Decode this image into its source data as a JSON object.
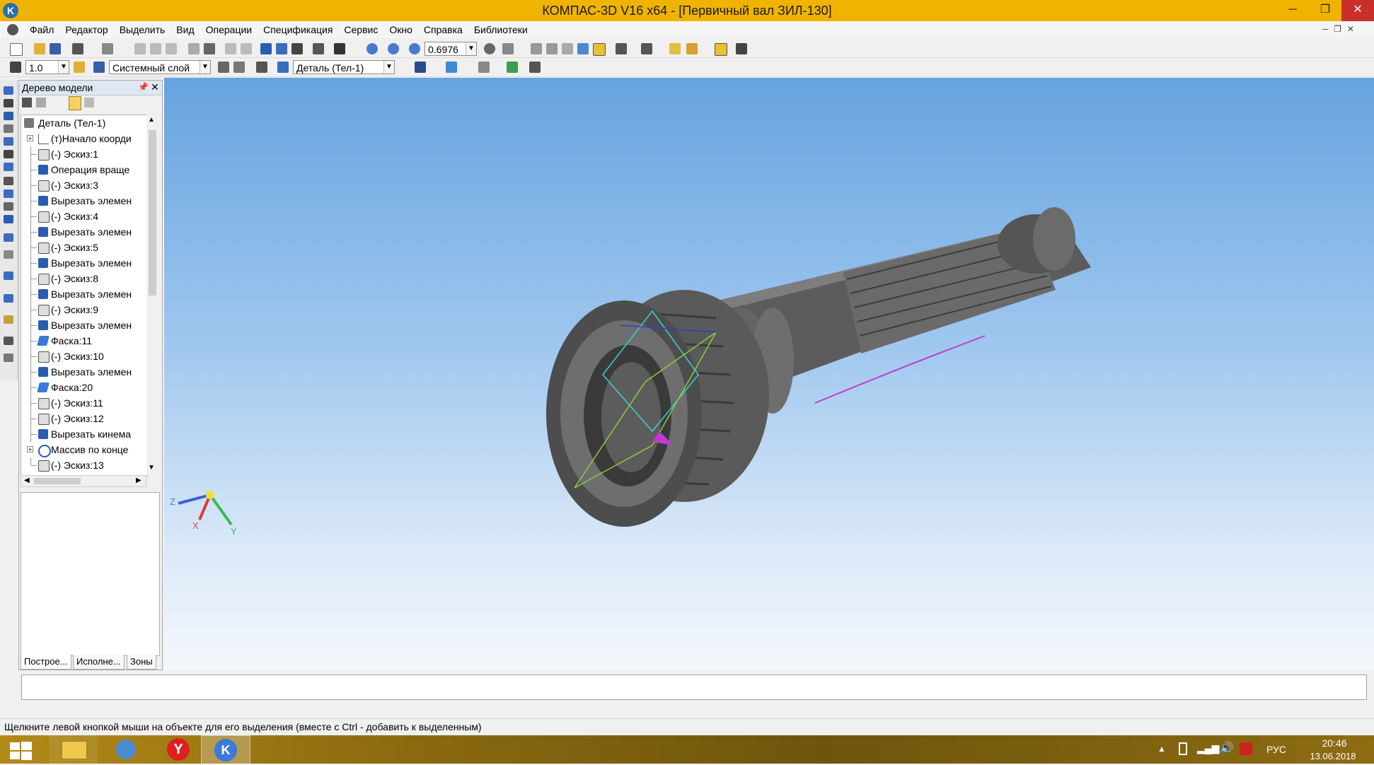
{
  "window": {
    "title": "КОМПАС-3D V16  x64 - [Первичный вал ЗИЛ-130]",
    "minimize_icon": "─",
    "maximize_icon": "❐",
    "close_icon": "✕"
  },
  "menu": [
    "Файл",
    "Редактор",
    "Выделить",
    "Вид",
    "Операции",
    "Спецификация",
    "Сервис",
    "Окно",
    "Справка",
    "Библиотеки"
  ],
  "toolbar": {
    "zoom_value": "0.6976",
    "line_style_value": "1.0",
    "layer_value": "Системный слой",
    "part_value": "Деталь (Тел-1)"
  },
  "tree": {
    "title": "Дерево модели",
    "root": "Деталь (Тел-1)",
    "items": [
      "(т)Начало коорди",
      "(-) Эскиз:1",
      "Операция враще",
      "(-) Эскиз:3",
      "Вырезать элемен",
      "(-) Эскиз:4",
      "Вырезать элемен",
      "(-) Эскиз:5",
      "Вырезать элемен",
      "(-) Эскиз:8",
      "Вырезать элемен",
      "(-) Эскиз:9",
      "Вырезать элемен",
      "Фаска:11",
      "(-) Эскиз:10",
      "Вырезать элемен",
      "Фаска:20",
      "(-) Эскиз:11",
      "(-) Эскиз:12",
      "Вырезать кинема",
      "Массив по конце",
      "(-) Эскиз:13"
    ],
    "tabs": [
      "Построе...",
      "Исполне...",
      "Зоны"
    ]
  },
  "axes": {
    "x": "X",
    "y": "Y",
    "z": "Z"
  },
  "status": "Щелкните левой кнопкой мыши на объекте для его выделения (вместе с Ctrl - добавить к выделенным)",
  "tray": {
    "time": "20:46",
    "date": "13.06.2018",
    "lang": "РУС"
  }
}
